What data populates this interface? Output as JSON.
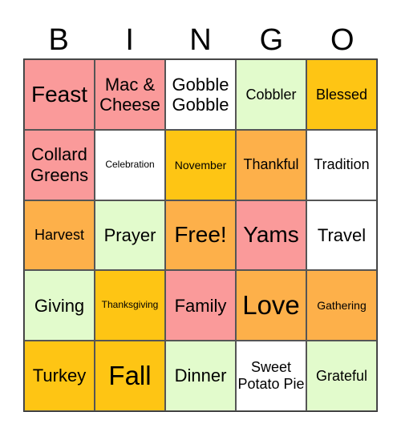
{
  "header": {
    "letters": [
      "B",
      "I",
      "N",
      "G",
      "O"
    ]
  },
  "colors": {
    "pink": "#fa9a9a",
    "white": "#ffffff",
    "green": "#e2fbcc",
    "yellow": "#fec514",
    "orange": "#fdb04a"
  },
  "cells": [
    {
      "text": "Feast",
      "color": "#fa9a9a",
      "size": "s-l"
    },
    {
      "text": "Mac & Cheese",
      "color": "#fa9a9a",
      "size": "s-m"
    },
    {
      "text": "Gobble Gobble",
      "color": "#ffffff",
      "size": "s-m"
    },
    {
      "text": "Cobbler",
      "color": "#e2fbcc",
      "size": "s-s"
    },
    {
      "text": "Blessed",
      "color": "#fec514",
      "size": "s-s"
    },
    {
      "text": "Collard Greens",
      "color": "#fa9a9a",
      "size": "s-m"
    },
    {
      "text": "Celebration",
      "color": "#ffffff",
      "size": "s-tiny"
    },
    {
      "text": "November",
      "color": "#fec514",
      "size": "s-xxs"
    },
    {
      "text": "Thankful",
      "color": "#fdb04a",
      "size": "s-s"
    },
    {
      "text": "Tradition",
      "color": "#ffffff",
      "size": "s-s"
    },
    {
      "text": "Harvest",
      "color": "#fdb04a",
      "size": "s-s"
    },
    {
      "text": "Prayer",
      "color": "#e2fbcc",
      "size": "s-m"
    },
    {
      "text": "Free!",
      "color": "#fdb04a",
      "size": "s-l"
    },
    {
      "text": "Yams",
      "color": "#fa9a9a",
      "size": "s-l"
    },
    {
      "text": "Travel",
      "color": "#ffffff",
      "size": "s-m"
    },
    {
      "text": "Giving",
      "color": "#e2fbcc",
      "size": "s-m"
    },
    {
      "text": "Thanksgiving",
      "color": "#fec514",
      "size": "s-tiny"
    },
    {
      "text": "Family",
      "color": "#fa9a9a",
      "size": "s-m"
    },
    {
      "text": "Love",
      "color": "#fdb04a",
      "size": "s-xl"
    },
    {
      "text": "Gathering",
      "color": "#fdb04a",
      "size": "s-xxs"
    },
    {
      "text": "Turkey",
      "color": "#fec514",
      "size": "s-m"
    },
    {
      "text": "Fall",
      "color": "#fec514",
      "size": "s-xl"
    },
    {
      "text": "Dinner",
      "color": "#e2fbcc",
      "size": "s-m"
    },
    {
      "text": "Sweet Potato Pie",
      "color": "#ffffff",
      "size": "s-s"
    },
    {
      "text": "Grateful",
      "color": "#e2fbcc",
      "size": "s-s"
    }
  ]
}
